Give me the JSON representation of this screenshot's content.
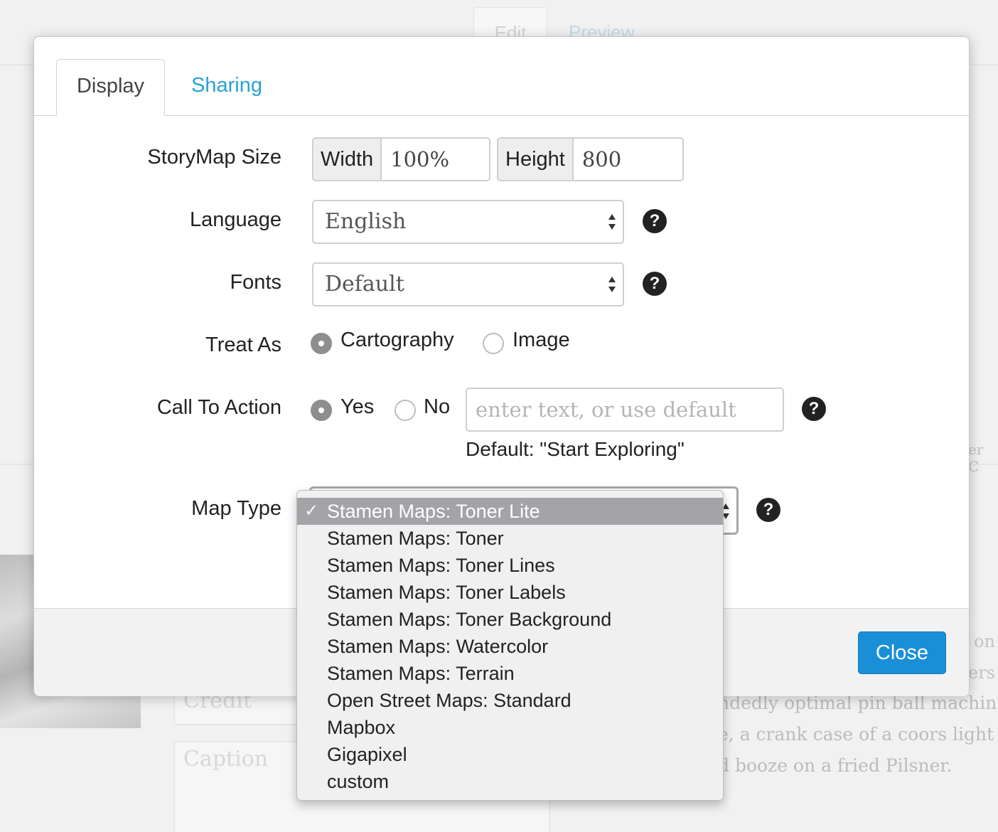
{
  "background": {
    "tabs": [
      "Edit",
      "Preview"
    ],
    "fields": [
      "Credit",
      "Caption"
    ],
    "text_lines": [
      "ndedly optimal pin ball machin",
      "e, a crank case of a coors light r",
      "d booze on a fried Pilsner."
    ],
    "fragments": [
      "on",
      "ers",
      "er C"
    ]
  },
  "modal": {
    "tabs": [
      {
        "label": "Display",
        "active": true
      },
      {
        "label": "Sharing",
        "active": false
      }
    ],
    "size": {
      "label": "StoryMap Size",
      "width_label": "Width",
      "width_value": "100%",
      "height_label": "Height",
      "height_value": "800"
    },
    "language": {
      "label": "Language",
      "value": "English"
    },
    "fonts": {
      "label": "Fonts",
      "value": "Default"
    },
    "treat_as": {
      "label": "Treat As",
      "options": [
        {
          "label": "Cartography",
          "checked": true
        },
        {
          "label": "Image",
          "checked": false
        }
      ]
    },
    "call_to_action": {
      "label": "Call To Action",
      "options": [
        {
          "label": "Yes",
          "checked": true
        },
        {
          "label": "No",
          "checked": false
        }
      ],
      "placeholder": "enter text, or use default",
      "hint": "Default: \"Start Exploring\""
    },
    "map_type": {
      "label": "Map Type",
      "selected": "Stamen Maps: Toner Lite",
      "check_glyph": "✓",
      "options": [
        "Stamen Maps: Toner Lite",
        "Stamen Maps: Toner",
        "Stamen Maps: Toner Lines",
        "Stamen Maps: Toner Labels",
        "Stamen Maps: Toner Background",
        "Stamen Maps: Watercolor",
        "Stamen Maps: Terrain",
        "Open Street Maps: Standard",
        "Mapbox",
        "Gigapixel",
        "custom"
      ]
    },
    "help_glyph": "?",
    "close_label": "Close"
  },
  "colors": {
    "link": "#26a4d8",
    "primary_button": "#1a8fd8",
    "selected_option": "#a3a3a8"
  }
}
